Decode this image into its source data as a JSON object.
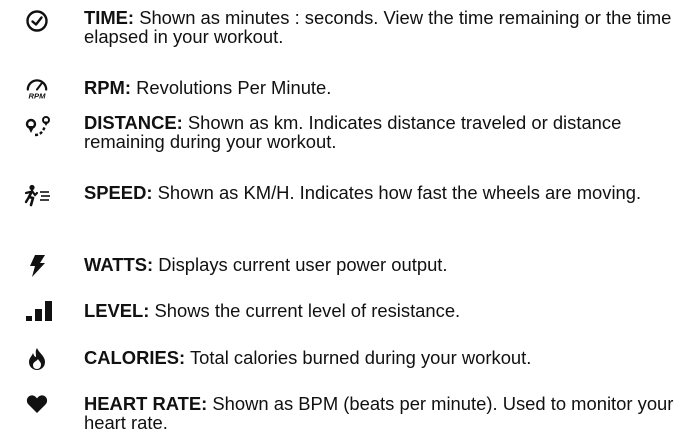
{
  "items": [
    {
      "icon": "clock-icon",
      "term": "TIME:",
      "description": "Shown as minutes : seconds. View the time remaining or the time elapsed in your workout."
    },
    {
      "icon": "rpm-gauge-icon",
      "icon_text": "RPM",
      "term": "RPM:",
      "description": "Revolutions Per Minute."
    },
    {
      "icon": "distance-pin-icon",
      "term": "DISTANCE:",
      "description": "Shown as km. Indicates distance traveled or distance remaining during your workout."
    },
    {
      "icon": "running-person-icon",
      "term": "SPEED:",
      "description": "Shown as KM/H. Indicates how fast the wheels are moving."
    },
    {
      "icon": "lightning-bolt-icon",
      "term": "WATTS:",
      "description": "Displays current user power output."
    },
    {
      "icon": "level-bars-icon",
      "term": "LEVEL:",
      "description": "Shows the current level of resistance."
    },
    {
      "icon": "flame-icon",
      "term": "CALORIES:",
      "description": "Total calories burned during your workout."
    },
    {
      "icon": "heart-icon",
      "term": "HEART RATE:",
      "description": "Shown as BPM (beats per minute). Used to monitor your heart rate."
    }
  ]
}
